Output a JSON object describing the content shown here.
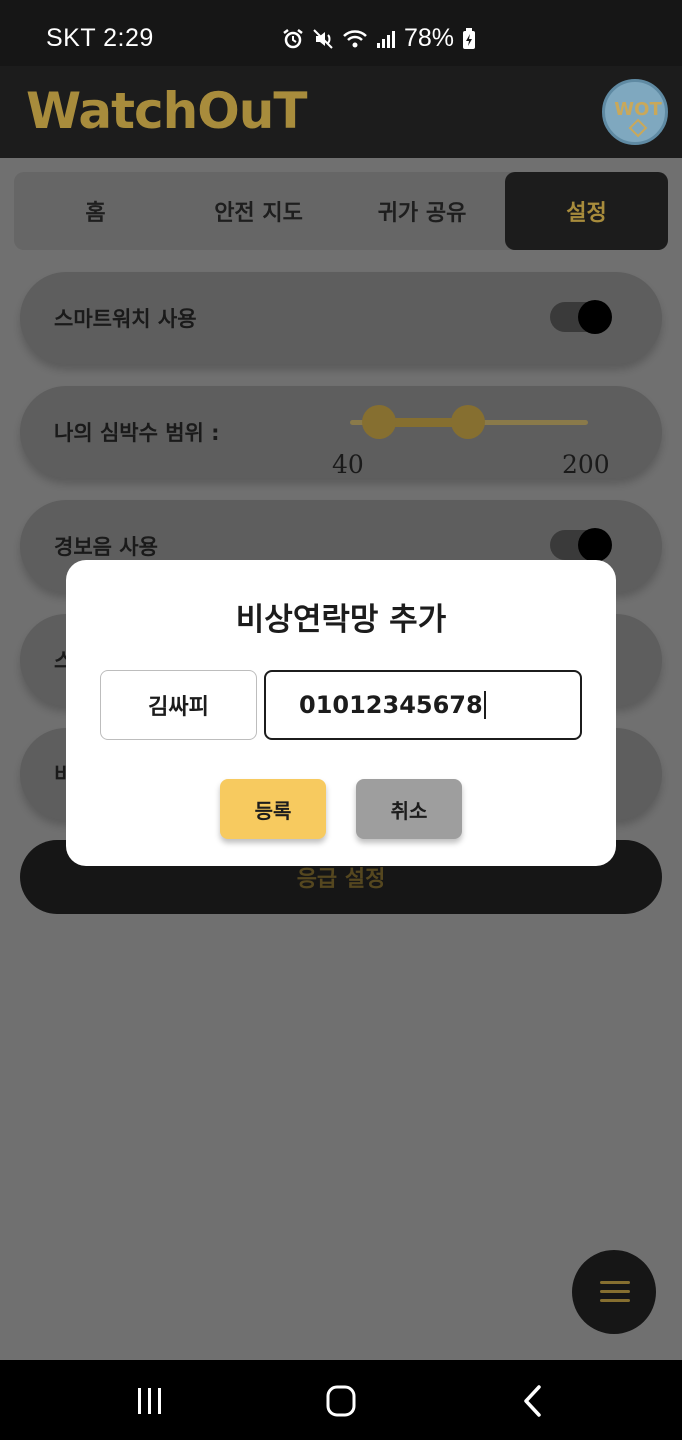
{
  "status_bar": {
    "carrier_time": "SKT 2:29",
    "battery": "78%"
  },
  "header": {
    "brand": "WatchOuT",
    "logo_text": "WOT"
  },
  "tabs": [
    {
      "label": "홈",
      "active": false
    },
    {
      "label": "안전 지도",
      "active": false
    },
    {
      "label": "귀가 공유",
      "active": false
    },
    {
      "label": "설정",
      "active": true
    }
  ],
  "settings": {
    "smartwatch": {
      "label": "스마트워치 사용",
      "enabled": true
    },
    "heart_rate": {
      "label": "나의 심박수 범위 :",
      "min_label": "40",
      "max_label": "200"
    },
    "alarm": {
      "label": "경보음 사용",
      "enabled": true
    },
    "row4_partial": "스",
    "row5_partial": "비",
    "emergency_button": "응급 설정"
  },
  "dialog": {
    "title": "비상연락망 추가",
    "name_value": "김싸피",
    "phone_value": "01012345678",
    "register_button": "등록",
    "cancel_button": "취소"
  },
  "colors": {
    "brand_gold": "#a88c3c",
    "register_yellow": "#f7ca5f",
    "dark": "#1c1c1c"
  },
  "icons": {
    "fab": "menu-icon",
    "nav": [
      "recent-apps-icon",
      "home-icon",
      "back-icon"
    ]
  }
}
